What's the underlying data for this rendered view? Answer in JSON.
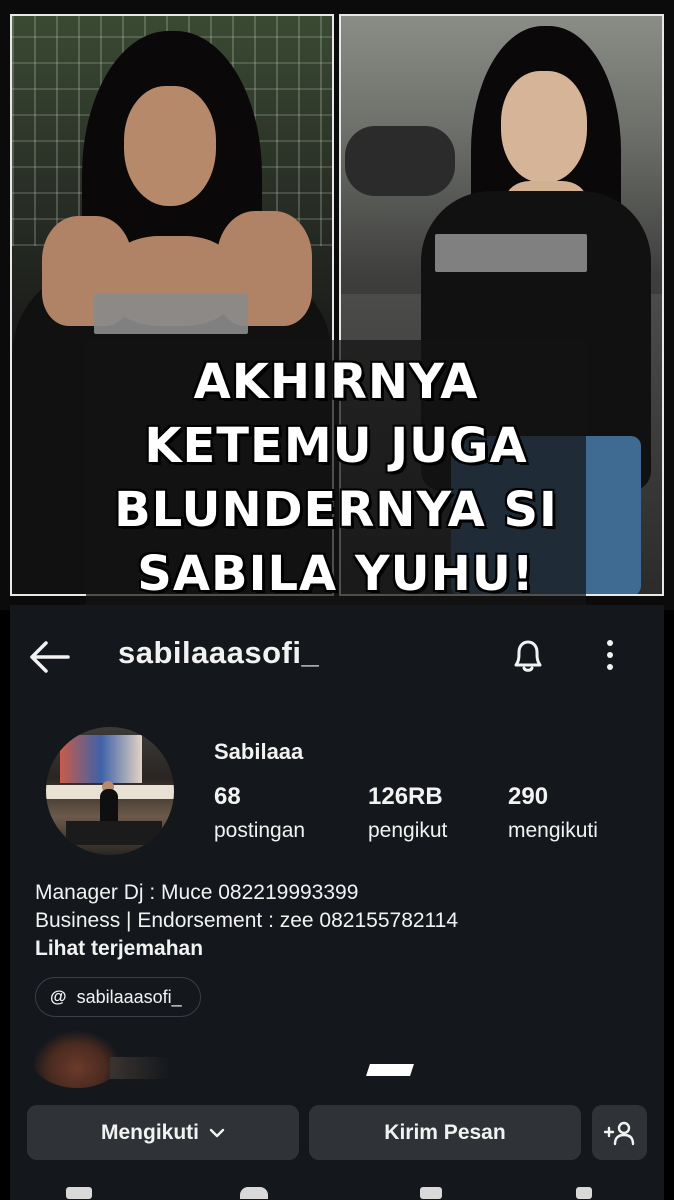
{
  "overlay": {
    "caption_lines": [
      "AKHIRNYA",
      "KETEMU JUGA",
      "BLUNDERNYA SI",
      "SABILA YUHU!"
    ]
  },
  "profile": {
    "username": "sabilaaasofi_",
    "display_name": "Sabilaaa",
    "stats": [
      {
        "value": "68",
        "label": "postingan"
      },
      {
        "value": "126RB",
        "label": "pengikut"
      },
      {
        "value": "290",
        "label": "mengikuti"
      }
    ],
    "bio_lines": [
      "Manager Dj : Muce 082219993399",
      "Business | Endorsement : zee 082155782114"
    ],
    "translate_link": "Lihat terjemahan",
    "threads_handle": "sabilaaasofi_"
  },
  "actions": {
    "follow_label": "Mengikuti",
    "message_label": "Kirim Pesan"
  },
  "icons": {
    "back": "back-arrow-icon",
    "bell": "bell-icon",
    "more": "more-vertical-icon",
    "threads": "threads-icon",
    "chevron": "chevron-down-icon",
    "add_person": "add-person-icon"
  },
  "colors": {
    "panel_bg": "#14181c",
    "button_bg": "#2f3337",
    "text": "#f2f2f2"
  }
}
